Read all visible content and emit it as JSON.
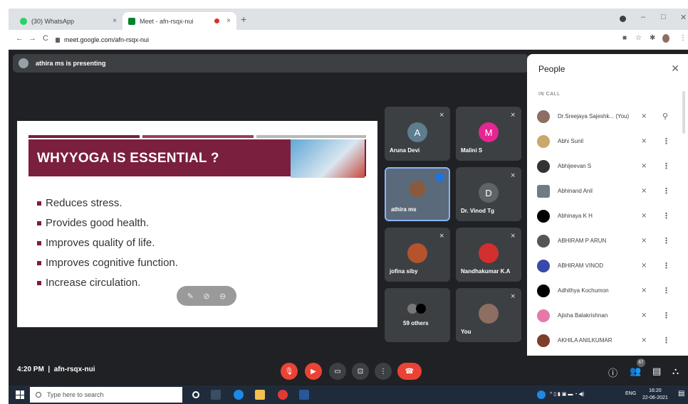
{
  "browser": {
    "tabs": [
      {
        "label": "(30) WhatsApp",
        "close": "×"
      },
      {
        "label": "Meet - afn-rsqx-nui",
        "close": "×"
      }
    ],
    "new_tab": "+",
    "url": "meet.google.com/afn-rsqx-nui",
    "nav": {
      "back": "←",
      "forward": "→",
      "reload": "C"
    },
    "window": {
      "minimize": "–",
      "restore": "□",
      "close": "✕"
    }
  },
  "presenting_banner": "athira ms is presenting",
  "slide": {
    "title": "WHYYOGA IS ESSENTIAL ?",
    "bullets": [
      "Reduces stress.",
      "Provides good health.",
      "Improves quality of life.",
      "Improves cognitive function.",
      "Increase circulation."
    ]
  },
  "tiles": [
    {
      "name": "Aruna Devi",
      "initial": "A",
      "color": "#5f7d8e"
    },
    {
      "name": "Malini S",
      "initial": "M",
      "color": "#e52592"
    },
    {
      "name": "athira ms"
    },
    {
      "name": "Dr. Vinod Tg",
      "initial": "D",
      "color": "#5f6368"
    },
    {
      "name": "jofina siby"
    },
    {
      "name": "Nandhakumar K.A"
    },
    {
      "name": "59 others"
    },
    {
      "name": "You"
    }
  ],
  "people": {
    "title": "People",
    "close": "✕",
    "section": "IN CALL",
    "list": [
      {
        "name": "Dr.Sreejaya Sajeshk...  (You)",
        "color": "#8d6e63"
      },
      {
        "name": "Abhi Sunil",
        "color": "#c9a86a"
      },
      {
        "name": "Abhijeevan S",
        "color": "#333333"
      },
      {
        "name": "Abhinand Anil",
        "color": "#6d7c8a"
      },
      {
        "name": "Abhinaya K H",
        "color": "#000000"
      },
      {
        "name": "ABHIRAM P ARUN",
        "color": "#555555"
      },
      {
        "name": "ABHIRAM VINOD",
        "color": "#3949ab"
      },
      {
        "name": "Adhithya Kochumon",
        "color": "#000000"
      },
      {
        "name": "Ajisha Balakrishnan",
        "color": "#e57aa8"
      },
      {
        "name": "AKHILA ANILKUMAR",
        "color": "#7b3f2a"
      }
    ]
  },
  "meetbar": {
    "time": "4:20 PM",
    "separator": "|",
    "code": "afn-rsqx-nui",
    "participant_count": "67"
  },
  "taskbar": {
    "search_placeholder": "Type here to search",
    "lang": "ENG",
    "time": "16:20",
    "date": "22-06-2021"
  }
}
